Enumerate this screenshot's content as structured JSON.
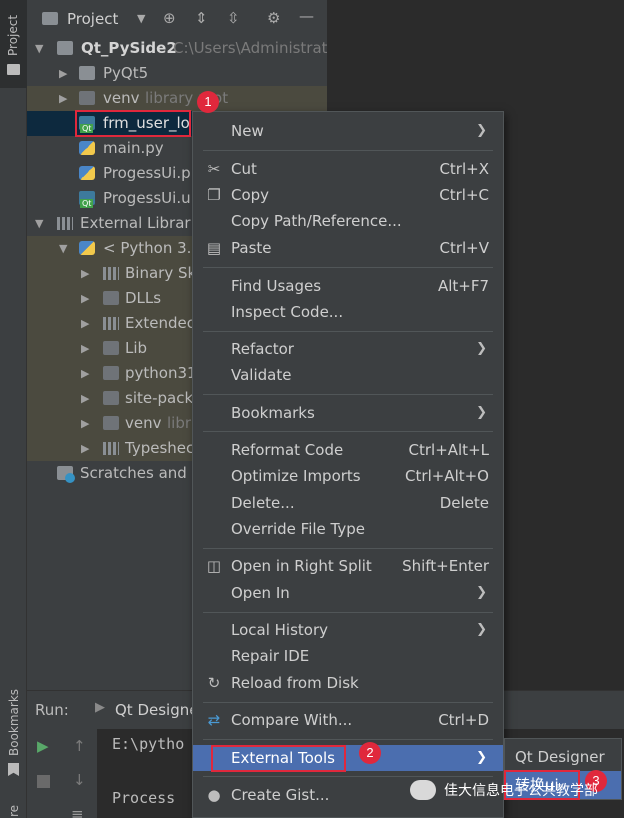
{
  "sidebar_left": {
    "project_tab": "Project",
    "bookmarks_tab": "Bookmarks",
    "structure_tab": "re"
  },
  "project_panel": {
    "title": "Project",
    "tree": [
      {
        "label": "Qt_PySide2",
        "hint": "C:\\Users\\Administrato"
      },
      {
        "label": "PyQt5",
        "hint": ""
      },
      {
        "label": "venv",
        "hint": "library root"
      },
      {
        "label": "frm_user_lo",
        "hint": ""
      },
      {
        "label": "main.py",
        "hint": ""
      },
      {
        "label": "ProgessUi.p",
        "hint": ""
      },
      {
        "label": "ProgessUi.u",
        "hint": ""
      },
      {
        "label": "External Librarie",
        "hint": ""
      },
      {
        "label": "< Python 3.1",
        "hint": ""
      },
      {
        "label": "Binary Sk",
        "hint": ""
      },
      {
        "label": "DLLs",
        "hint": ""
      },
      {
        "label": "Extendec",
        "hint": ""
      },
      {
        "label": "Lib",
        "hint": ""
      },
      {
        "label": "python31",
        "hint": ""
      },
      {
        "label": "site-pack",
        "hint": ""
      },
      {
        "label": "venv",
        "hint": "libr"
      },
      {
        "label": "Typeshec",
        "hint": ""
      },
      {
        "label": "Scratches and C",
        "hint": ""
      }
    ]
  },
  "run_panel": {
    "label": "Run:",
    "tab": "Qt Designe",
    "line1": "E:\\pytho",
    "line2": "Process"
  },
  "context_menu": {
    "items": [
      {
        "label": "New",
        "shortcut": "",
        "submenu": true
      },
      {
        "label": "Cut",
        "shortcut": "Ctrl+X"
      },
      {
        "label": "Copy",
        "shortcut": "Ctrl+C"
      },
      {
        "label": "Copy Path/Reference...",
        "shortcut": ""
      },
      {
        "label": "Paste",
        "shortcut": "Ctrl+V"
      },
      {
        "label": "Find Usages",
        "shortcut": "Alt+F7"
      },
      {
        "label": "Inspect Code...",
        "shortcut": ""
      },
      {
        "label": "Refactor",
        "shortcut": "",
        "submenu": true
      },
      {
        "label": "Validate",
        "shortcut": ""
      },
      {
        "label": "Bookmarks",
        "shortcut": "",
        "submenu": true
      },
      {
        "label": "Reformat Code",
        "shortcut": "Ctrl+Alt+L"
      },
      {
        "label": "Optimize Imports",
        "shortcut": "Ctrl+Alt+O"
      },
      {
        "label": "Delete...",
        "shortcut": "Delete"
      },
      {
        "label": "Override File Type",
        "shortcut": ""
      },
      {
        "label": "Open in Right Split",
        "shortcut": "Shift+Enter"
      },
      {
        "label": "Open In",
        "shortcut": "",
        "submenu": true
      },
      {
        "label": "Local History",
        "shortcut": "",
        "submenu": true
      },
      {
        "label": "Repair IDE",
        "shortcut": ""
      },
      {
        "label": "Reload from Disk",
        "shortcut": ""
      },
      {
        "label": "Compare With...",
        "shortcut": "Ctrl+D"
      },
      {
        "label": "External Tools",
        "shortcut": "",
        "submenu": true
      },
      {
        "label": "Create Gist...",
        "shortcut": ""
      }
    ]
  },
  "external_tools_submenu": {
    "items": [
      "Qt Designer",
      "转换ui"
    ]
  },
  "annotations": {
    "badge1": "1",
    "badge2": "2",
    "badge3": "3"
  },
  "watermark": {
    "text": "佳大信息电子公共教学部"
  },
  "colors": {
    "highlight": "#4b6eaf",
    "annotation_red": "#e0283c",
    "library_bg": "#4b4a3f",
    "selected_bg": "#0d293e"
  }
}
